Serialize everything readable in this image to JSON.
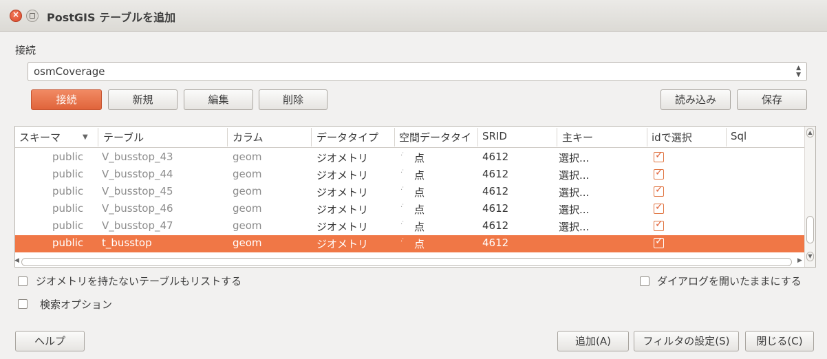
{
  "window": {
    "title": "PostGIS テーブルを追加"
  },
  "connection": {
    "label": "接続",
    "selected": "osmCoverage",
    "buttons": {
      "connect": "接続",
      "new": "新規",
      "edit": "編集",
      "delete": "削除",
      "load": "読み込み",
      "save": "保存"
    }
  },
  "table": {
    "columns": [
      "スキーマ",
      "テーブル",
      "カラム",
      "データタイプ",
      "空間データタイ",
      "SRID",
      "主キー",
      "idで選択",
      "Sql"
    ],
    "sort_indicator": "▼",
    "rows": [
      {
        "schema": "public",
        "table": "V_busstop_43",
        "column": "geom",
        "datatype": "ジオメトリ",
        "spatial": "点",
        "srid": "4612",
        "pk": "選択...",
        "select_by_id": true,
        "selected": false
      },
      {
        "schema": "public",
        "table": "V_busstop_44",
        "column": "geom",
        "datatype": "ジオメトリ",
        "spatial": "点",
        "srid": "4612",
        "pk": "選択...",
        "select_by_id": true,
        "selected": false
      },
      {
        "schema": "public",
        "table": "V_busstop_45",
        "column": "geom",
        "datatype": "ジオメトリ",
        "spatial": "点",
        "srid": "4612",
        "pk": "選択...",
        "select_by_id": true,
        "selected": false
      },
      {
        "schema": "public",
        "table": "V_busstop_46",
        "column": "geom",
        "datatype": "ジオメトリ",
        "spatial": "点",
        "srid": "4612",
        "pk": "選択...",
        "select_by_id": true,
        "selected": false
      },
      {
        "schema": "public",
        "table": "V_busstop_47",
        "column": "geom",
        "datatype": "ジオメトリ",
        "spatial": "点",
        "srid": "4612",
        "pk": "選択...",
        "select_by_id": true,
        "selected": false
      },
      {
        "schema": "public",
        "table": "t_busstop",
        "column": "geom",
        "datatype": "ジオメトリ",
        "spatial": "点",
        "srid": "4612",
        "pk": "",
        "select_by_id": true,
        "selected": true
      }
    ]
  },
  "options": {
    "list_without_geometry": "ジオメトリを持たないテーブルもリストする",
    "keep_dialog_open": "ダイアログを開いたままにする",
    "search_options": "検索オプション"
  },
  "footer": {
    "help": "ヘルプ",
    "add": "追加(A)",
    "filter": "フィルタの設定(S)",
    "close": "閉じる(C)"
  },
  "colors": {
    "accent": "#f07746",
    "selected_row": "#f07746"
  }
}
